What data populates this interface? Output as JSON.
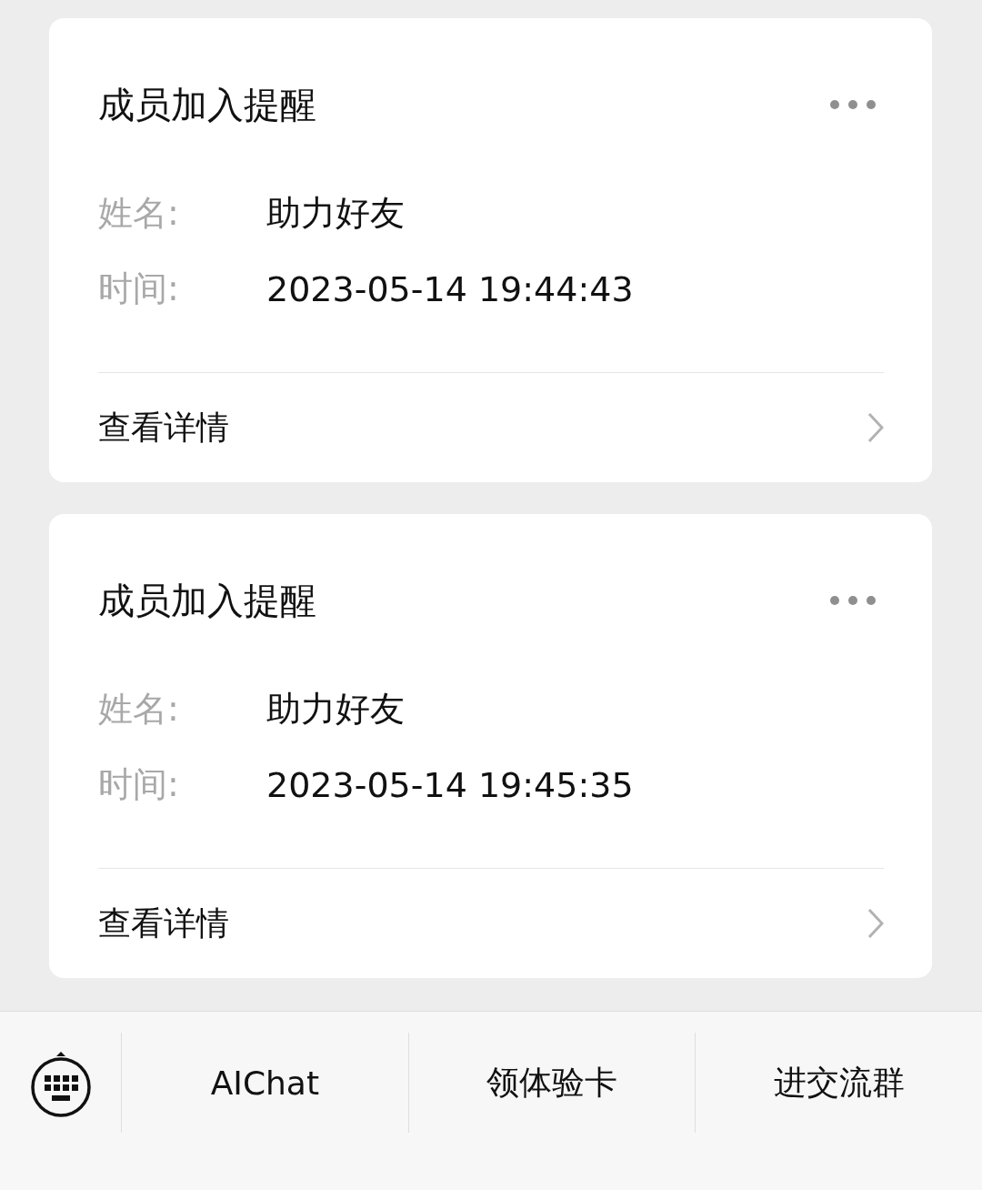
{
  "cards": [
    {
      "title": "成员加入提醒",
      "fields": [
        {
          "label": "姓名:",
          "value": "助力好友"
        },
        {
          "label": "时间:",
          "value": "2023-05-14 19:44:43"
        }
      ],
      "link": "查看详情"
    },
    {
      "title": "成员加入提醒",
      "fields": [
        {
          "label": "姓名:",
          "value": "助力好友"
        },
        {
          "label": "时间:",
          "value": "2023-05-14 19:45:35"
        }
      ],
      "link": "查看详情"
    }
  ],
  "menu_bar": {
    "items": [
      "AIChat",
      "领体验卡",
      "进交流群"
    ]
  }
}
